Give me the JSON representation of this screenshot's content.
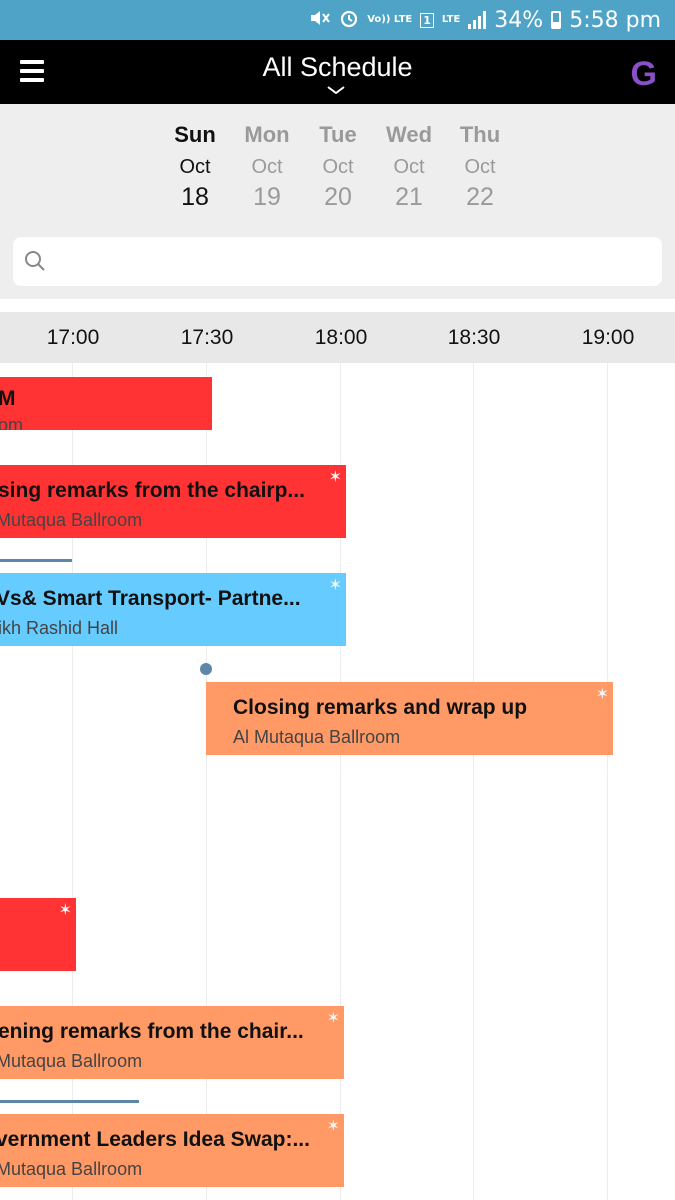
{
  "status_bar": {
    "battery": "34%",
    "time": "5:58 pm",
    "sim_slot": "1",
    "volte": "Vo)) LTE",
    "lte": "LTE",
    "icons": [
      "mute-icon",
      "alarm-icon",
      "volte-icon",
      "sim-icon",
      "lte-signal-icon",
      "signal-icon",
      "battery-icon"
    ]
  },
  "app_bar": {
    "title": "All Schedule",
    "menu_icon": "hamburger-menu-icon",
    "logo_text": "G"
  },
  "dates": [
    {
      "dow": "Sun",
      "month": "Oct",
      "day": "18",
      "selected": true
    },
    {
      "dow": "Mon",
      "month": "Oct",
      "day": "19",
      "selected": false
    },
    {
      "dow": "Tue",
      "month": "Oct",
      "day": "20",
      "selected": false
    },
    {
      "dow": "Wed",
      "month": "Oct",
      "day": "21",
      "selected": false
    },
    {
      "dow": "Thu",
      "month": "Oct",
      "day": "22",
      "selected": false
    }
  ],
  "search": {
    "placeholder": "",
    "value": ""
  },
  "timeline": {
    "times": [
      "17:00",
      "17:30",
      "18:00",
      "18:30",
      "19:00"
    ]
  },
  "events": [
    {
      "title": "M",
      "location": "om",
      "color": "#ff3333",
      "starred": false
    },
    {
      "title": "sing remarks from the chairp...",
      "location": "Mutaqua Ballroom",
      "color": "#ff3333",
      "starred": true
    },
    {
      "title": "Vs& Smart Transport- Partne...",
      "location": "ikh Rashid Hall",
      "color": "#66ccff",
      "starred": true
    },
    {
      "title": "Closing remarks and wrap up",
      "location": "Al Mutaqua Ballroom",
      "color": "#ff9966",
      "starred": true
    },
    {
      "title": "",
      "location": "",
      "color": "#ff3333",
      "starred": true
    },
    {
      "title": "ening remarks from the chair...",
      "location": "Mutaqua Ballroom",
      "color": "#ff9966",
      "starred": true
    },
    {
      "title": "vernment Leaders Idea Swap:...",
      "location": "Mutaqua Ballroom",
      "color": "#ff9966",
      "starred": true
    }
  ],
  "colors": {
    "status_bar": "#4fa3c7",
    "app_bar": "#000000",
    "logo": "#8a4fc9",
    "red_event": "#ff3333",
    "blue_event": "#66ccff",
    "orange_event": "#ff9966",
    "connector": "#5b88a8"
  }
}
